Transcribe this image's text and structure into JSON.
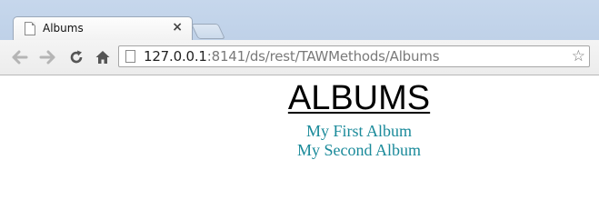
{
  "browser": {
    "tab": {
      "title": "Albums",
      "close_glyph": "×"
    },
    "address_bar": {
      "host": "127.0.0.1",
      "rest": ":8141/ds/rest/TAWMethods/Albums"
    },
    "icons": {
      "back": "back-arrow-icon",
      "forward": "forward-arrow-icon",
      "reload": "reload-icon",
      "home": "home-icon",
      "bookmark": "star-icon",
      "star_glyph": "☆"
    }
  },
  "page": {
    "heading": "ALBUMS",
    "albums": [
      {
        "label": "My First Album"
      },
      {
        "label": "My Second Album"
      }
    ]
  },
  "colors": {
    "link": "#1a8a9a",
    "tabstrip": "#c6d7ec"
  }
}
